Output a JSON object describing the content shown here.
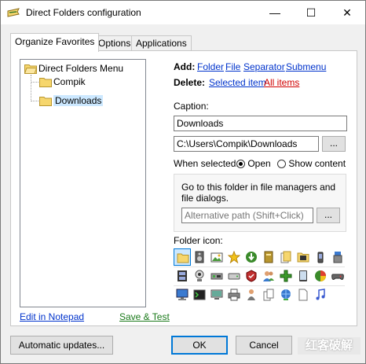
{
  "window": {
    "title": "Direct Folders configuration",
    "controls": {
      "minimize": "—",
      "maximize": "☐",
      "close": "✕"
    }
  },
  "tabs": [
    {
      "label": "Organize Favorites",
      "active": true
    },
    {
      "label": "Options",
      "active": false
    },
    {
      "label": "Applications",
      "active": false
    }
  ],
  "tree": {
    "root": "Direct Folders Menu",
    "children": [
      "Compik",
      "Downloads"
    ],
    "selected": "Downloads"
  },
  "links": {
    "edit_notepad": "Edit in Notepad",
    "save_test": "Save & Test"
  },
  "add": {
    "label": "Add:",
    "folder": "Folder",
    "file": "File",
    "separator": "Separator",
    "submenu": "Submenu"
  },
  "delete": {
    "label": "Delete:",
    "selected": "Selected item",
    "all": "All items"
  },
  "caption": {
    "label": "Caption:",
    "value": "Downloads"
  },
  "path": {
    "value": "C:\\Users\\Compik\\Downloads",
    "browse": "..."
  },
  "when_selected": {
    "label": "When selected:",
    "open": "Open",
    "show_content": "Show content",
    "selected_option": "open"
  },
  "goto": {
    "text": "Go to this folder in file managers and file dialogs.",
    "alt_placeholder": "Alternative path (Shift+Click)",
    "browse": "..."
  },
  "folder_icon": {
    "label": "Folder icon:",
    "selected_index": 0
  },
  "icons": [
    "folder-icon",
    "speaker-icon",
    "picture-icon",
    "star-icon",
    "download-icon",
    "book-icon",
    "documents-icon",
    "film-folder-icon",
    "phone-icon",
    "usb-icon",
    "film-icon",
    "web-cam-icon",
    "network-icon",
    "drive-icon",
    "shield-icon",
    "users-icon",
    "plus-icon",
    "tablet-icon",
    "pie-chart-icon",
    "gamepad-icon",
    "desktop-icon",
    "terminal-icon",
    "monitor-icon",
    "printer-icon",
    "person-icon",
    "copy-icon",
    "network-globe-icon",
    "blank-page-icon",
    "music-note-icon"
  ],
  "buttons": {
    "auto_updates": "Automatic updates...",
    "ok": "OK",
    "cancel": "Cancel"
  },
  "watermark": "红客破解",
  "colors": {
    "accent": "#0078d7",
    "link": "#0033cc",
    "delete_all": "#d00000",
    "save_test": "#1a7a1a",
    "selection": "#cce8ff",
    "folder": "#f6d66d"
  }
}
